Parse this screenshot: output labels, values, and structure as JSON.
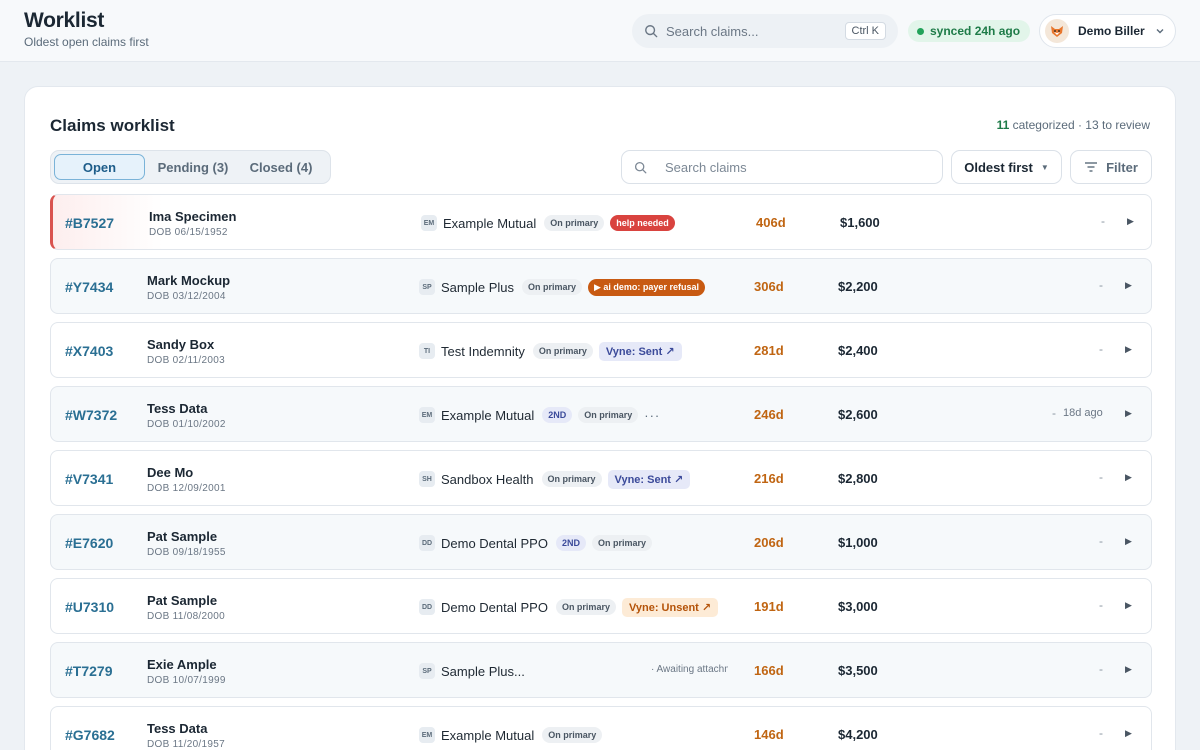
{
  "header": {
    "title": "Worklist",
    "subtitle": "Oldest open claims first",
    "search_placeholder": "Search claims...",
    "search_shortcut": "Ctrl K",
    "sync_status": "synced 24h ago",
    "user_name": "Demo Biller"
  },
  "card": {
    "title": "Claims worklist",
    "categorized_count": "11",
    "stats_rest": "categorized · 13 to review"
  },
  "tabs": [
    {
      "label": "Open"
    },
    {
      "label": "Pending (3)"
    },
    {
      "label": "Closed (4)"
    }
  ],
  "controls": {
    "search_placeholder": "Search claims",
    "sort_label": "Oldest first",
    "filter_label": "Filter"
  },
  "rows": [
    {
      "id": "#B7527",
      "name": "Ima Specimen",
      "dob": "DOB 06/15/1952",
      "payer_code": "EM",
      "payer": "Example Mutual",
      "chips": [
        {
          "text": "On primary",
          "style": "gray"
        },
        {
          "text": "help needed",
          "style": "red"
        }
      ],
      "age": "406d",
      "amount": "$1,600",
      "last": "-"
    },
    {
      "id": "#Y7434",
      "name": "Mark Mockup",
      "dob": "DOB 03/12/2004",
      "payer_code": "SP",
      "payer": "Sample Plus",
      "chips": [
        {
          "text": "On primary",
          "style": "gray"
        },
        {
          "text": "▶ ai demo: payer refusal",
          "style": "orange"
        }
      ],
      "age": "306d",
      "amount": "$2,200",
      "last": "-"
    },
    {
      "id": "#X7403",
      "name": "Sandy Box",
      "dob": "DOB 02/11/2003",
      "payer_code": "TI",
      "payer": "Test Indemnity",
      "chips": [
        {
          "text": "On primary",
          "style": "gray"
        },
        {
          "text": "Vyne: Sent ↗",
          "style": "vsent"
        }
      ],
      "age": "281d",
      "amount": "$2,400",
      "last": "-"
    },
    {
      "id": "#W7372",
      "name": "Tess Data",
      "dob": "DOB 01/10/2002",
      "payer_code": "EM",
      "payer": "Example Mutual",
      "chips": [
        {
          "text": "2ND",
          "style": "twond"
        },
        {
          "text": "On primary",
          "style": "gray"
        }
      ],
      "more": "···",
      "age": "246d",
      "amount": "$2,600",
      "last": "-",
      "ago": "18d ago"
    },
    {
      "id": "#V7341",
      "name": "Dee Mo",
      "dob": "DOB 12/09/2001",
      "payer_code": "SH",
      "payer": "Sandbox Health",
      "chips": [
        {
          "text": "On primary",
          "style": "gray"
        },
        {
          "text": "Vyne: Sent ↗",
          "style": "vsent"
        }
      ],
      "age": "216d",
      "amount": "$2,800",
      "last": "-"
    },
    {
      "id": "#E7620",
      "name": "Pat Sample",
      "dob": "DOB 09/18/1955",
      "payer_code": "DD",
      "payer": "Demo Dental PPO",
      "chips": [
        {
          "text": "2ND",
          "style": "twond"
        },
        {
          "text": "On primary",
          "style": "gray"
        }
      ],
      "age": "206d",
      "amount": "$1,000",
      "last": "-"
    },
    {
      "id": "#U7310",
      "name": "Pat Sample",
      "dob": "DOB 11/08/2000",
      "payer_code": "DD",
      "payer": "Demo Dental PPO",
      "chips": [
        {
          "text": "On primary",
          "style": "gray"
        },
        {
          "text": "Vyne: Unsent ↗",
          "style": "vunsent"
        }
      ],
      "age": "191d",
      "amount": "$3,000",
      "last": "-"
    },
    {
      "id": "#T7279",
      "name": "Exie Ample",
      "dob": "DOB 10/07/1999",
      "payer_code": "SP",
      "payer": "Sample Plus...",
      "chips": [],
      "awaiting": "· Awaiting attachment",
      "age": "166d",
      "amount": "$3,500",
      "last": "-"
    },
    {
      "id": "#G7682",
      "name": "Tess Data",
      "dob": "DOB 11/20/1957",
      "payer_code": "EM",
      "payer": "Example Mutual",
      "chips": [
        {
          "text": "On primary",
          "style": "gray"
        }
      ],
      "age": "146d",
      "amount": "$4,200",
      "last": "-"
    }
  ]
}
